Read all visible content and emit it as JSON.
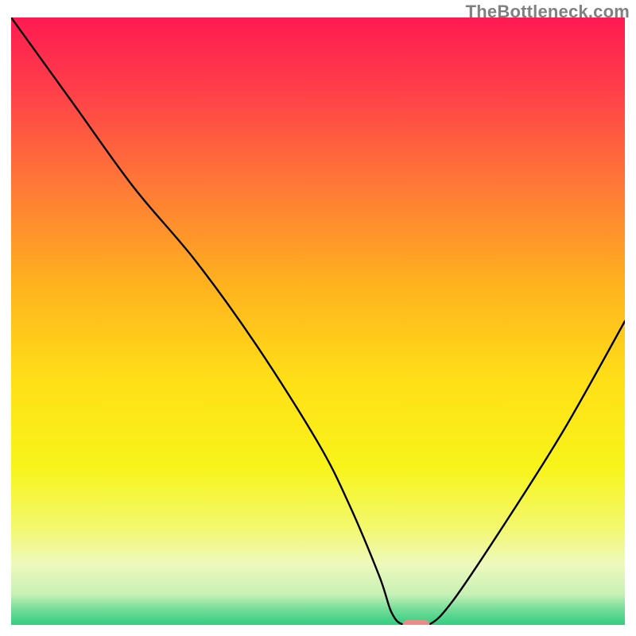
{
  "watermark": "TheBottleneck.com",
  "chart_data": {
    "type": "line",
    "title": "",
    "xlabel": "",
    "ylabel": "",
    "xlim": [
      0,
      100
    ],
    "ylim": [
      0,
      100
    ],
    "grid": false,
    "legend": false,
    "annotations": [],
    "series": [
      {
        "name": "curve",
        "x": [
          0,
          10,
          20,
          30,
          40,
          50,
          55,
          60,
          62,
          64,
          68,
          72,
          80,
          90,
          100
        ],
        "y": [
          100,
          86,
          72,
          60,
          46,
          30,
          20,
          8,
          2,
          0,
          0,
          4,
          16,
          32,
          50
        ]
      }
    ],
    "markers": [
      {
        "name": "optimum",
        "x": 66,
        "y": 0,
        "shape": "pill",
        "color": "#e88b89"
      }
    ],
    "gradient_stops": [
      {
        "offset": 0.0,
        "color": "#ff1a52"
      },
      {
        "offset": 0.12,
        "color": "#ff3f49"
      },
      {
        "offset": 0.28,
        "color": "#ff7a36"
      },
      {
        "offset": 0.44,
        "color": "#ffb21e"
      },
      {
        "offset": 0.6,
        "color": "#ffe017"
      },
      {
        "offset": 0.74,
        "color": "#f8f41a"
      },
      {
        "offset": 0.84,
        "color": "#f3f86e"
      },
      {
        "offset": 0.9,
        "color": "#eef9bd"
      },
      {
        "offset": 0.95,
        "color": "#c6f0b5"
      },
      {
        "offset": 0.975,
        "color": "#72dd99"
      },
      {
        "offset": 1.0,
        "color": "#32cd80"
      }
    ]
  }
}
